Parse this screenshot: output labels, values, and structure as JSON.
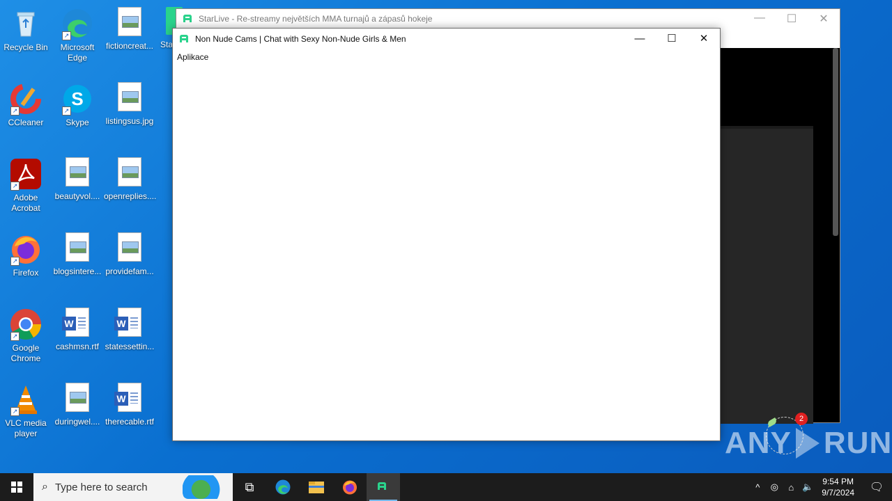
{
  "desktop_icons": [
    {
      "label": "Recycle Bin"
    },
    {
      "label": "Microsoft Edge"
    },
    {
      "label": "fictioncreat..."
    },
    {
      "label": "Sta"
    },
    {
      "label": "CCleaner"
    },
    {
      "label": "Skype"
    },
    {
      "label": "listingsus.jpg"
    },
    {
      "label": "Adobe Acrobat"
    },
    {
      "label": "beautyvol...."
    },
    {
      "label": "openreplies...."
    },
    {
      "label": "Firefox"
    },
    {
      "label": "blogsintere..."
    },
    {
      "label": "providefam..."
    },
    {
      "label": "Google Chrome"
    },
    {
      "label": "cashmsn.rtf"
    },
    {
      "label": "statessettin..."
    },
    {
      "label": "VLC media player"
    },
    {
      "label": "duringwel...."
    },
    {
      "label": "therecable.rtf"
    }
  ],
  "bg_window": {
    "title": "StarLive - Re-streamy největších MMA turnajů a zápasů hokeje",
    "minimize": "—",
    "maximize": "☐",
    "close": "✕",
    "badge_count": "2"
  },
  "fg_window": {
    "title": "Non Nude Cams | Chat with Sexy Non-Nude Girls & Men",
    "menu_item": "Aplikace",
    "minimize": "—",
    "maximize": "☐",
    "close": "✕"
  },
  "watermark": {
    "left": "ANY",
    "right": "RUN"
  },
  "taskbar": {
    "search_placeholder": "Type here to search",
    "search_icon": "⌕",
    "task_view_icon": "⧉",
    "apps": [
      "edge-icon",
      "file-explorer-icon",
      "firefox-icon",
      "app-icon"
    ],
    "tray": {
      "chevron": "^",
      "meet": "◎",
      "network": "⌂",
      "volume": "🔈",
      "time": "9:54 PM",
      "date": "9/7/2024",
      "notification": "🗨"
    }
  },
  "colors": {
    "accent_green": "#2ad38c",
    "desktop_blue": "#0a6fd0",
    "taskbar": "#1c1c1c"
  }
}
